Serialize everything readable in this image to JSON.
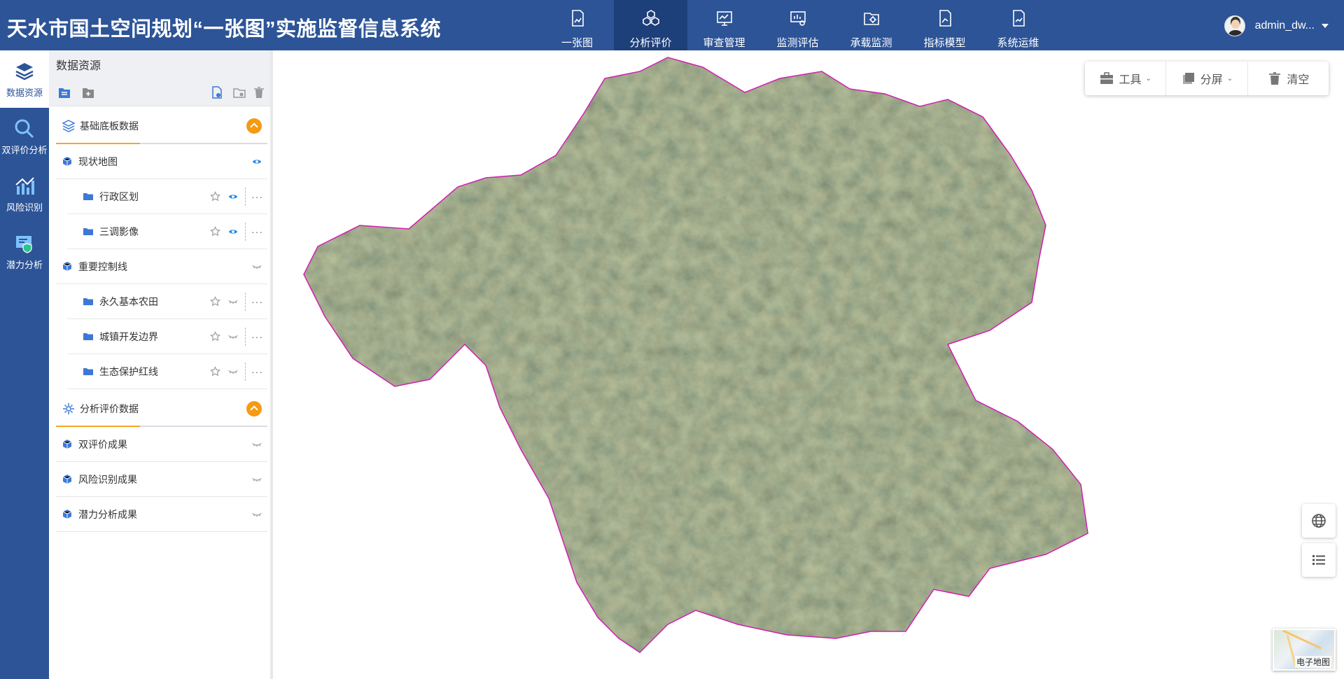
{
  "header": {
    "title": "天水市国土空间规划“一张图”实施监督信息系统",
    "nav": [
      {
        "label": "一张图",
        "icon": "map-doc-icon"
      },
      {
        "label": "分析评价",
        "icon": "cubes-icon",
        "active": true
      },
      {
        "label": "审查管理",
        "icon": "chart-board-icon"
      },
      {
        "label": "监测评估",
        "icon": "monitor-icon"
      },
      {
        "label": "承载监测",
        "icon": "folder-gear-icon"
      },
      {
        "label": "指标模型",
        "icon": "doc-chart-icon"
      },
      {
        "label": "系统运维",
        "icon": "doc-gear-icon"
      }
    ],
    "user": "admin_dw..."
  },
  "rail": [
    {
      "label": "数据资源",
      "icon": "layers-icon",
      "active": true
    },
    {
      "label": "双评价分析",
      "icon": "search-icon"
    },
    {
      "label": "风险识别",
      "icon": "bar-chart-icon"
    },
    {
      "label": "潜力分析",
      "icon": "shield-board-icon"
    }
  ],
  "panel": {
    "title": "数据资源",
    "groups": [
      {
        "label": "基础底板数据",
        "rows": [
          {
            "label": "现状地图",
            "level": 0,
            "visible": true
          },
          {
            "label": "行政区划",
            "level": 1,
            "visible": true
          },
          {
            "label": "三调影像",
            "level": 1,
            "visible": true
          },
          {
            "label": "重要控制线",
            "level": 0,
            "visible": false
          },
          {
            "label": "永久基本农田",
            "level": 1,
            "visible": false
          },
          {
            "label": "城镇开发边界",
            "level": 1,
            "visible": false
          },
          {
            "label": "生态保护红线",
            "level": 1,
            "visible": false
          }
        ]
      },
      {
        "label": "分析评价数据",
        "rows": [
          {
            "label": "双评价成果",
            "level": 0,
            "visible": false
          },
          {
            "label": "风险识别成果",
            "level": 0,
            "visible": false
          },
          {
            "label": "潜力分析成果",
            "level": 0,
            "visible": false
          }
        ]
      }
    ]
  },
  "map_tools": {
    "tools": "工具",
    "split": "分屏",
    "clear": "清空"
  },
  "basemap": {
    "label": "电子地图"
  },
  "colors": {
    "primary": "#2c5497",
    "active_nav": "#1d3f7a",
    "accent": "#f59a12",
    "boundary": "#d11fb0"
  }
}
